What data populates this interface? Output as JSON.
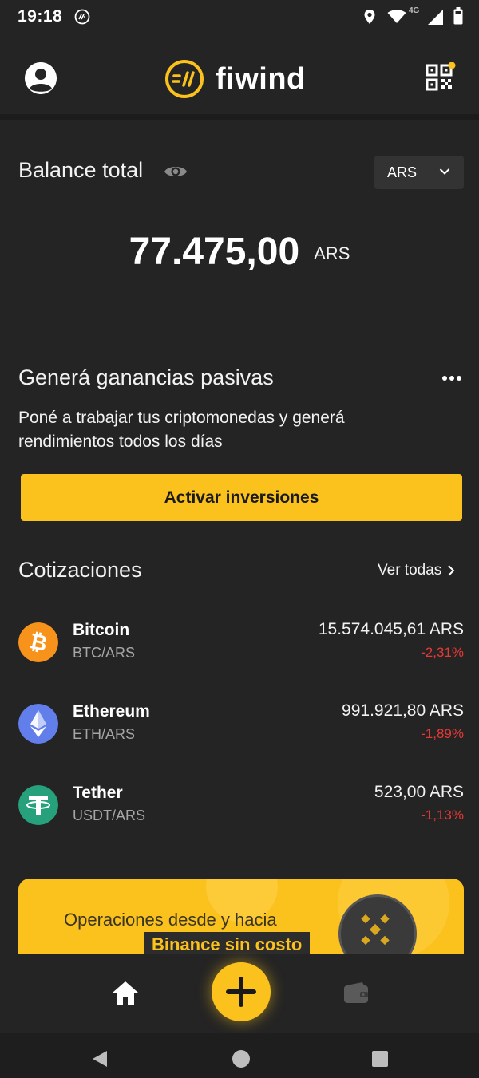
{
  "status_bar": {
    "time": "19:18",
    "network": "4G",
    "icons": [
      "app-notification-icon",
      "location-icon",
      "wifi-icon",
      "signal-icon",
      "battery-icon"
    ]
  },
  "header": {
    "logo_text": "fiwind",
    "icons": [
      "profile-icon",
      "qr-code-icon"
    ],
    "accent_color": "#fbc21d"
  },
  "balance": {
    "title": "Balance total",
    "currency_select": "ARS",
    "amount": "77.475,00",
    "currency": "ARS"
  },
  "promo": {
    "title": "Generá ganancias pasivas",
    "text": "Poné a trabajar tus criptomonedas y generá rendimientos todos los días",
    "button": "Activar inversiones"
  },
  "quotes": {
    "title": "Cotizaciones",
    "view_all": "Ver todas",
    "items": [
      {
        "name": "Bitcoin",
        "pair": "BTC/ARS",
        "price": "15.574.045,61 ARS",
        "change": "-2,31%",
        "color": "#f7931a",
        "icon": "bitcoin-icon"
      },
      {
        "name": "Ethereum",
        "pair": "ETH/ARS",
        "price": "991.921,80 ARS",
        "change": "-1,89%",
        "color": "#627eea",
        "icon": "ethereum-icon"
      },
      {
        "name": "Tether",
        "pair": "USDT/ARS",
        "price": "523,00 ARS",
        "change": "-1,13%",
        "color": "#26a17b",
        "icon": "tether-icon"
      }
    ]
  },
  "banner": {
    "line1": "Operaciones desde y hacia",
    "line2": "Binance sin costo"
  },
  "bottom_nav": {
    "items": [
      "home-icon",
      "add-icon",
      "wallet-icon"
    ]
  }
}
